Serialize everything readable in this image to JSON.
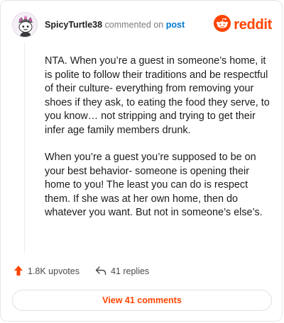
{
  "header": {
    "username": "SpicyTurtle38",
    "action_text": "commented on",
    "post_link": "post",
    "avatar_icon": "snoo-avatar-icon",
    "brand_icon": "reddit-logo-icon",
    "brand_name": "reddit"
  },
  "comment": {
    "paragraphs": [
      "NTA. When you’re a guest in someone’s home, it is polite to follow their traditions and be respectful of their culture- everything from removing your shoes if they ask, to eating the food they serve, to you know… not stripping and trying to get their infer age family members drunk.",
      "When you’re a guest you’re supposed to be on your best behavior- someone is opening their home to you! The least you can do is respect them. If she was at her own home, then do whatever you want. But not in someone’s else’s."
    ]
  },
  "stats": {
    "upvotes": "1.8K upvotes",
    "upvote_icon": "upvote-arrow-icon",
    "replies": "41 replies",
    "reply_icon": "reply-arrow-icon"
  },
  "footer": {
    "view_comments_label": "View 41 comments"
  },
  "colors": {
    "brand": "#ff4500",
    "link": "#0079d3",
    "muted": "#7c7c7c"
  }
}
